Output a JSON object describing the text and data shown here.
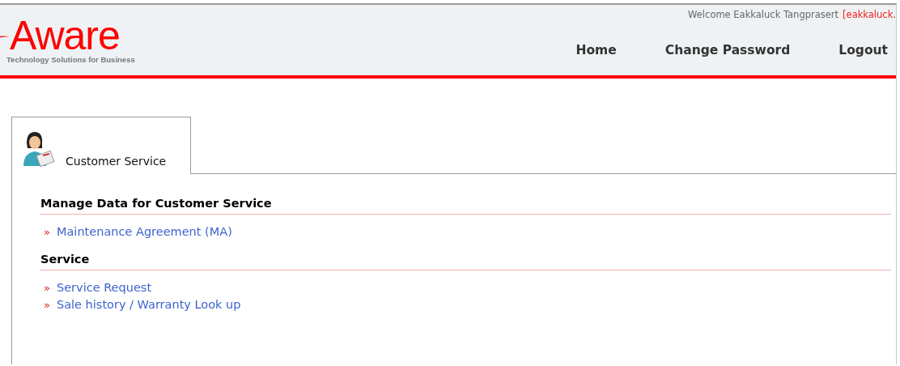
{
  "header": {
    "logo": {
      "name": "Aware",
      "tagline": "Technology Solutions for Business"
    },
    "welcome": "Welcome Eakkaluck Tangprasert",
    "user_tag": "[eakkaluck.",
    "nav": [
      {
        "label": "Home"
      },
      {
        "label": "Change Password"
      },
      {
        "label": "Logout"
      }
    ]
  },
  "tabs": [
    {
      "label": "Customer Service",
      "selected": true
    }
  ],
  "sections": [
    {
      "title": "Manage Data for Customer Service",
      "links": [
        {
          "bullet": "»",
          "label": "Maintenance Agreement (MA)"
        }
      ]
    },
    {
      "title": "Service",
      "links": [
        {
          "bullet": "»",
          "label": "Service Request"
        },
        {
          "bullet": "»",
          "label": "Sale history / Warranty Look up"
        }
      ]
    }
  ]
}
